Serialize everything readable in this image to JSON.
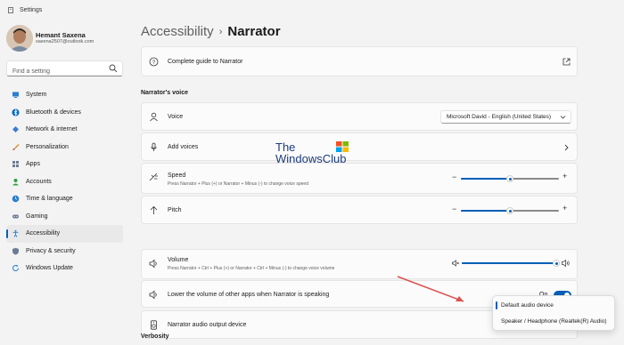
{
  "window": {
    "title": "Settings"
  },
  "user": {
    "name": "Hemant Saxena",
    "email": "saxena2507@outlook.com"
  },
  "search": {
    "placeholder": "Find a setting"
  },
  "sidebar": {
    "items": [
      {
        "label": "System",
        "icon": "system-icon",
        "active": false
      },
      {
        "label": "Bluetooth & devices",
        "icon": "bluetooth-icon",
        "active": false
      },
      {
        "label": "Network & internet",
        "icon": "network-icon",
        "active": false
      },
      {
        "label": "Personalization",
        "icon": "brush-icon",
        "active": false
      },
      {
        "label": "Apps",
        "icon": "apps-icon",
        "active": false
      },
      {
        "label": "Accounts",
        "icon": "accounts-icon",
        "active": false
      },
      {
        "label": "Time & language",
        "icon": "time-language-icon",
        "active": false
      },
      {
        "label": "Gaming",
        "icon": "gaming-icon",
        "active": false
      },
      {
        "label": "Accessibility",
        "icon": "accessibility-icon",
        "active": true
      },
      {
        "label": "Privacy & security",
        "icon": "shield-icon",
        "active": false
      },
      {
        "label": "Windows Update",
        "icon": "windows-update-icon",
        "active": false
      }
    ]
  },
  "breadcrumb": {
    "parent": "Accessibility",
    "separator": "›",
    "current": "Narrator"
  },
  "guide": {
    "label": "Complete guide to Narrator"
  },
  "voice_section": {
    "title": "Narrator's voice"
  },
  "voice": {
    "label": "Voice",
    "selected": "Microsoft David - English (United States)"
  },
  "add_voices": {
    "label": "Add voices"
  },
  "speed": {
    "label": "Speed",
    "description": "Press Narrator + Plus (+) or Narrator + Minus (-) to change voice speed",
    "value": 0.5
  },
  "pitch": {
    "label": "Pitch",
    "value": 0.5
  },
  "volume": {
    "label": "Volume",
    "description": "Press Narrator + Ctrl + Plus (+) or Narrator + Ctrl + Minus (-) to change voice volume",
    "value": 1.0
  },
  "lower_volume": {
    "label": "Lower the volume of other apps when Narrator is speaking",
    "state": "On",
    "on": true
  },
  "audio_output": {
    "label": "Narrator audio output device",
    "options": [
      "Default audio device",
      "Speaker / Headphone (Realtek(R) Audio)"
    ],
    "selected": "Default audio device"
  },
  "verbosity_section": {
    "title": "Verbosity"
  },
  "watermark": {
    "line1": "The",
    "line2": "WindowsClub"
  },
  "colors": {
    "accent": "#005fb8",
    "background": "#f3f3f3",
    "card": "#fbfbfb",
    "arrow": "#d9534f"
  }
}
